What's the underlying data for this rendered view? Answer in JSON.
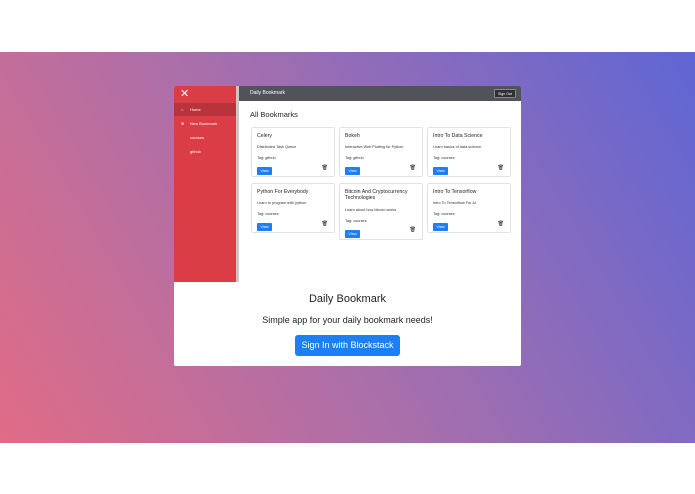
{
  "app": {
    "title": "Daily Bookmark",
    "sign_out": "Sign Out"
  },
  "sidebar": {
    "close_icon": "close-icon",
    "items": [
      {
        "label": "Home",
        "icon": "home-icon",
        "active": true
      },
      {
        "label": "New Bookmark",
        "icon": "plus-icon",
        "active": false
      },
      {
        "label": "courses",
        "active": false
      },
      {
        "label": "github",
        "active": false
      }
    ]
  },
  "main": {
    "section_title": "All Bookmarks",
    "cards": [
      {
        "title": "Celery",
        "description": "Distributed Task Queue",
        "tag": "Tag: github",
        "view": "View"
      },
      {
        "title": "Bokeh",
        "description": "Interactive Web Plotting for Python",
        "tag": "Tag: github",
        "view": "View"
      },
      {
        "title": "Intro To Data Science",
        "description": "Learn basics of data science",
        "tag": "Tag: courses",
        "view": "View"
      },
      {
        "title": "Python For Everybody",
        "description": "Learn to program with python",
        "tag": "Tag: courses",
        "view": "View"
      },
      {
        "title": "Bitcoin And Cryptocurrency Technologies",
        "description": "Learn about how bitcoin works",
        "tag": "Tag: courses",
        "view": "View"
      },
      {
        "title": "Intro To Tensorflow",
        "description": "Intro To Tensorflow For AI",
        "tag": "Tag: courses",
        "view": "View"
      }
    ]
  },
  "hero": {
    "title": "Daily Bookmark",
    "subtitle": "Simple app for your daily bookmark needs!",
    "signin": "Sign In with Blockstack"
  },
  "colors": {
    "sidebar": "#db3d46",
    "topbar": "#50535a",
    "accent": "#1d7ff5"
  }
}
